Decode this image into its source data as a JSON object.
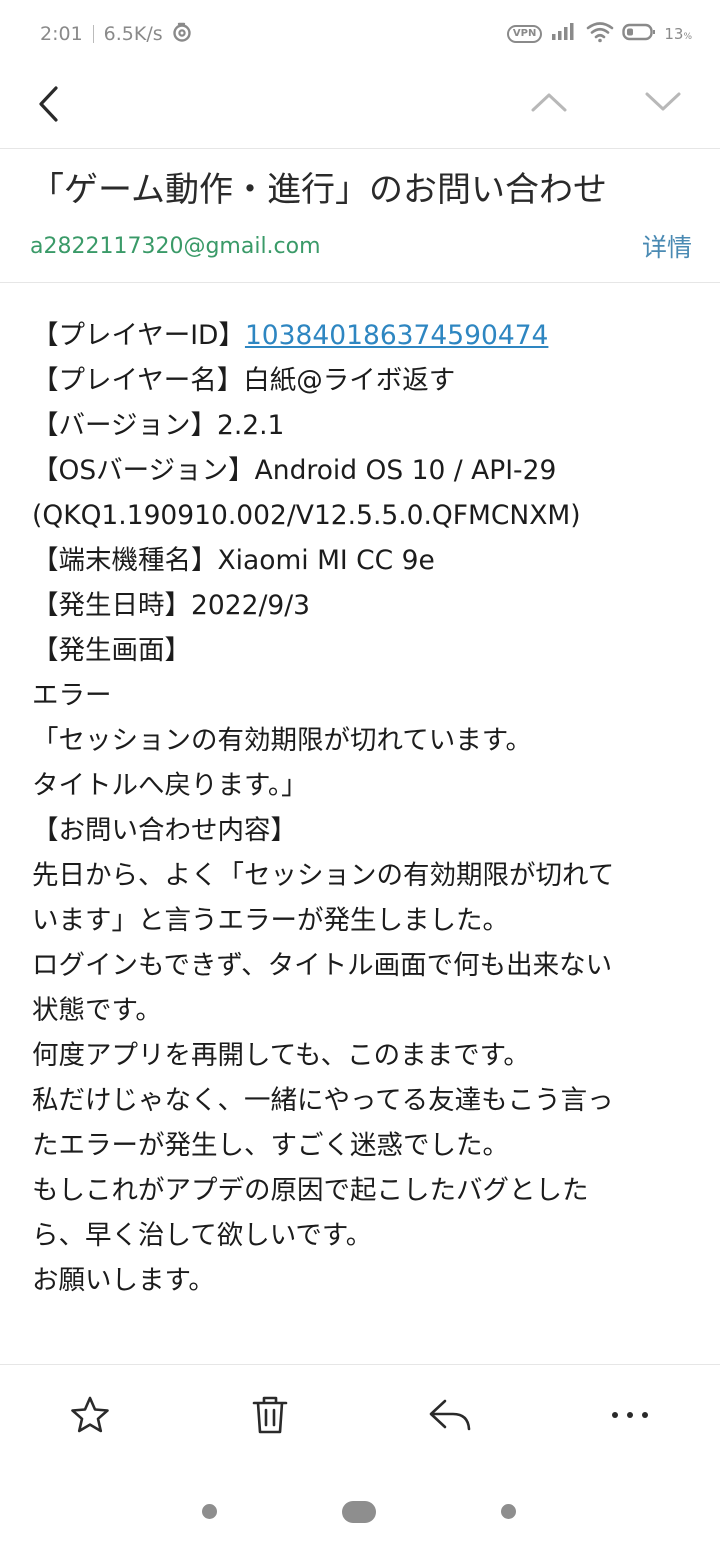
{
  "status_bar": {
    "time": "2:01",
    "net_speed": "6.5K/s",
    "vpn": "VPN",
    "battery": "13"
  },
  "nav": {
    "back_icon": "chevron-left-icon",
    "prev_icon": "chevron-up-icon",
    "next_icon": "chevron-down-icon"
  },
  "email": {
    "subject": "「ゲーム動作・進行」のお問い合わせ",
    "sender": "a2822117320@gmail.com",
    "details_label": "详情",
    "body": {
      "player_id_label": "【プレイヤーID】",
      "player_id": "103840186374590474",
      "lines": [
        "【プレイヤー名】白紙@ライボ返す",
        "【バージョン】2.2.1",
        "【OSバージョン】Android OS 10 / API-29",
        "(QKQ1.190910.002/V12.5.5.0.QFMCNXM)",
        "【端末機種名】Xiaomi MI CC 9e",
        "【発生日時】2022/9/3",
        "【発生画面】",
        "エラー",
        "「セッションの有効期限が切れています。",
        "タイトルへ戻ります。」",
        "【お問い合わせ内容】",
        "先日から、よく「セッションの有効期限が切れて",
        "います」と言うエラーが発生しました。",
        "ログインもできず、タイトル画面で何も出来ない",
        "状態です。",
        "何度アプリを再開しても、このままです。",
        "私だけじゃなく、一緒にやってる友達もこう言っ",
        "たエラーが発生し、すごく迷惑でした。",
        "もしこれがアプデの原因で起こしたバグとした",
        "ら、早く治して欲しいです。",
        "お願いします。"
      ]
    }
  },
  "toolbar": {
    "star_icon": "star-icon",
    "delete_icon": "trash-icon",
    "reply_icon": "reply-icon",
    "more_icon": "more-icon"
  },
  "colors": {
    "sender": "#3a9a68",
    "link": "#2e86c1",
    "details": "#4a8ab3",
    "icon_gray": "#8a8a8a"
  }
}
